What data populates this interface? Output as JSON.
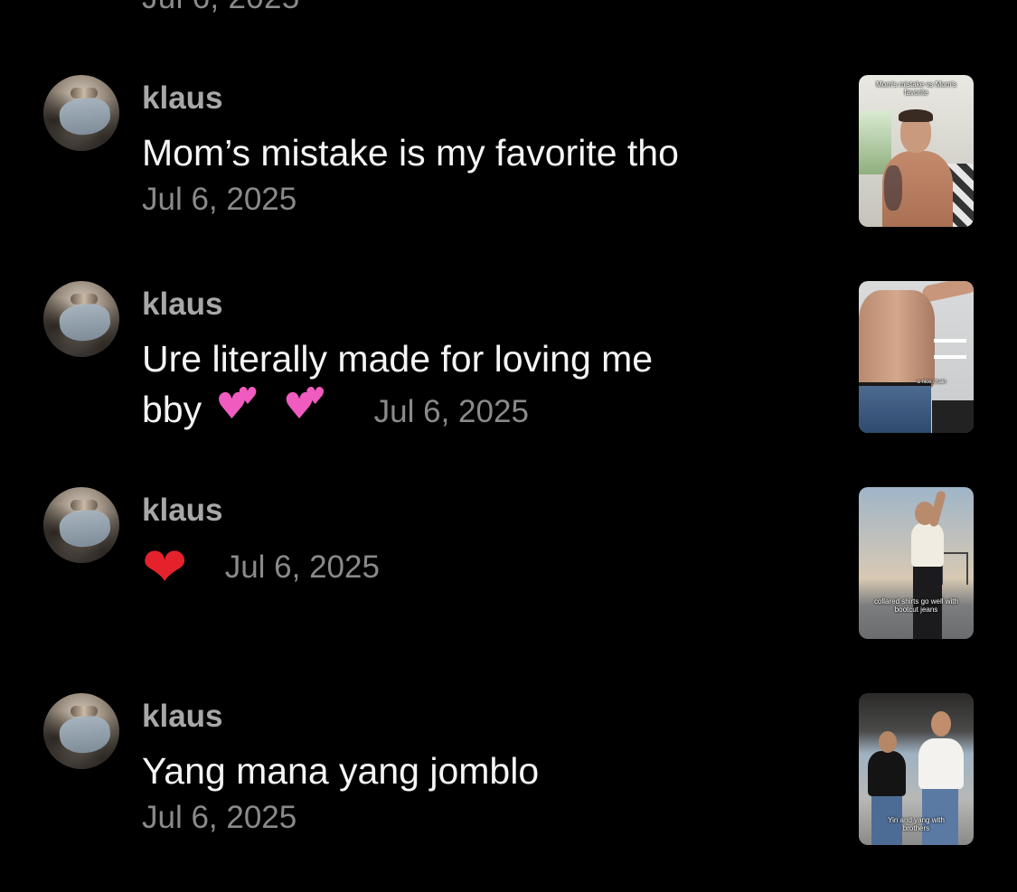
{
  "previous_comment": {
    "date": "Jul 6, 2025"
  },
  "comments": [
    {
      "username": "klaus",
      "text": "Mom’s mistake is my favorite tho",
      "date": "Jul 6, 2025",
      "thumbnail_caption": "Mom's mistake vs Mom's favorite"
    },
    {
      "username": "klaus",
      "text_line1": "Ure literally made for loving me",
      "text_line2": "bby",
      "emoji": [
        "two-hearts",
        "two-hearts"
      ],
      "date": "Jul 6, 2025",
      "thumbnail_caption": "a nice chain"
    },
    {
      "username": "klaus",
      "emoji": "red-heart",
      "date": "Jul 6, 2025",
      "thumbnail_caption": "collared shirts go well with bootcut jeans"
    },
    {
      "username": "klaus",
      "text": "Yang mana yang jomblo",
      "date": "Jul 6, 2025",
      "thumbnail_caption": "Yin and yang with brothers"
    }
  ],
  "colors": {
    "background": "#000000",
    "username": "#a8a8a8",
    "text": "#f5f5f5",
    "date": "#8a8a8a",
    "red_heart": "#e5222b",
    "pink_heart": "#f05bbf"
  }
}
